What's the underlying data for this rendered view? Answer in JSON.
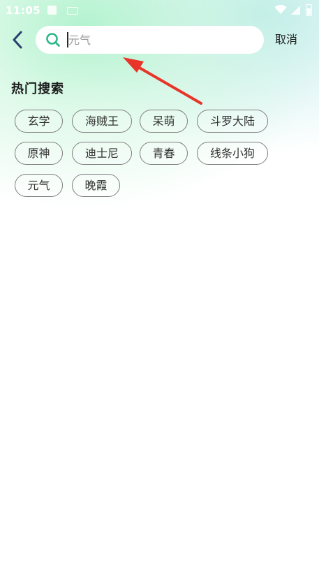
{
  "status_bar": {
    "time": "11:05",
    "icons": [
      "notification-a-icon",
      "keyboard-icon",
      "wifi-icon",
      "signal-icon",
      "battery-icon"
    ]
  },
  "header": {
    "back_icon": "chevron-left-icon",
    "search": {
      "icon": "search-icon",
      "placeholder": "元气",
      "value": ""
    },
    "cancel_label": "取消"
  },
  "hot_search": {
    "title": "热门搜索",
    "tags": [
      {
        "label": "玄学"
      },
      {
        "label": "海贼王"
      },
      {
        "label": "呆萌"
      },
      {
        "label": "斗罗大陆"
      },
      {
        "label": "原神"
      },
      {
        "label": "迪士尼"
      },
      {
        "label": "青春"
      },
      {
        "label": "线条小狗"
      },
      {
        "label": "元气"
      },
      {
        "label": "晚霞"
      }
    ]
  },
  "colors": {
    "accent": "#2bb88a",
    "back_icon": "#2a3d6e",
    "annotation_arrow": "#e8352a",
    "tag_border": "#7f7f7f"
  }
}
